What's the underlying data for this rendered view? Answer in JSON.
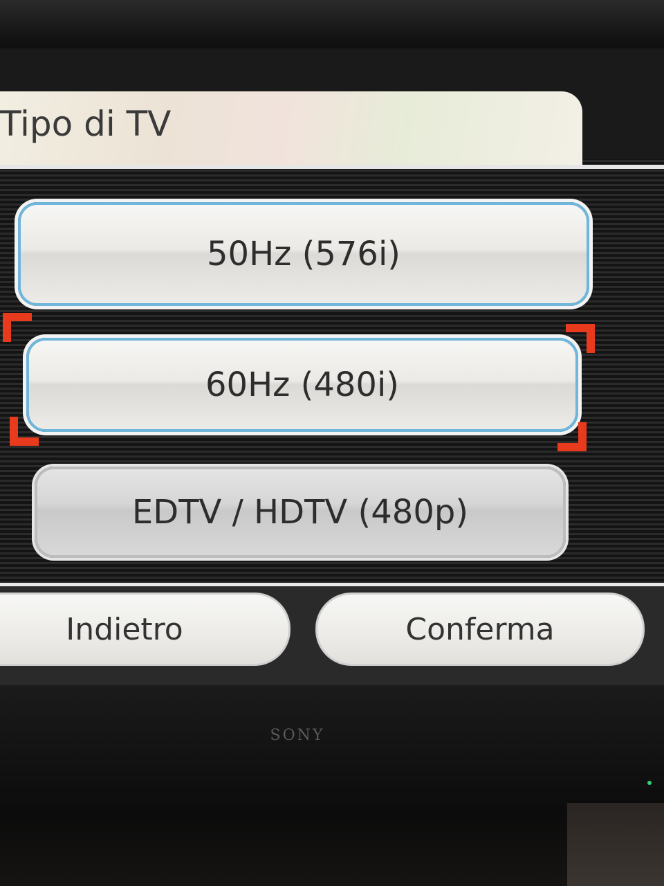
{
  "dialog": {
    "title": "Tipo di TV"
  },
  "options": [
    {
      "label": "50Hz (576i)",
      "state": "enabled"
    },
    {
      "label": "60Hz (480i)",
      "state": "focused"
    },
    {
      "label": "EDTV / HDTV (480p)",
      "state": "disabled"
    }
  ],
  "footer": {
    "back_label": "Indietro",
    "confirm_label": "Conferma"
  },
  "device": {
    "brand_logo": "SONY"
  },
  "colors": {
    "focus_bracket": "#e83a1c",
    "option_border": "#6fb6da"
  }
}
